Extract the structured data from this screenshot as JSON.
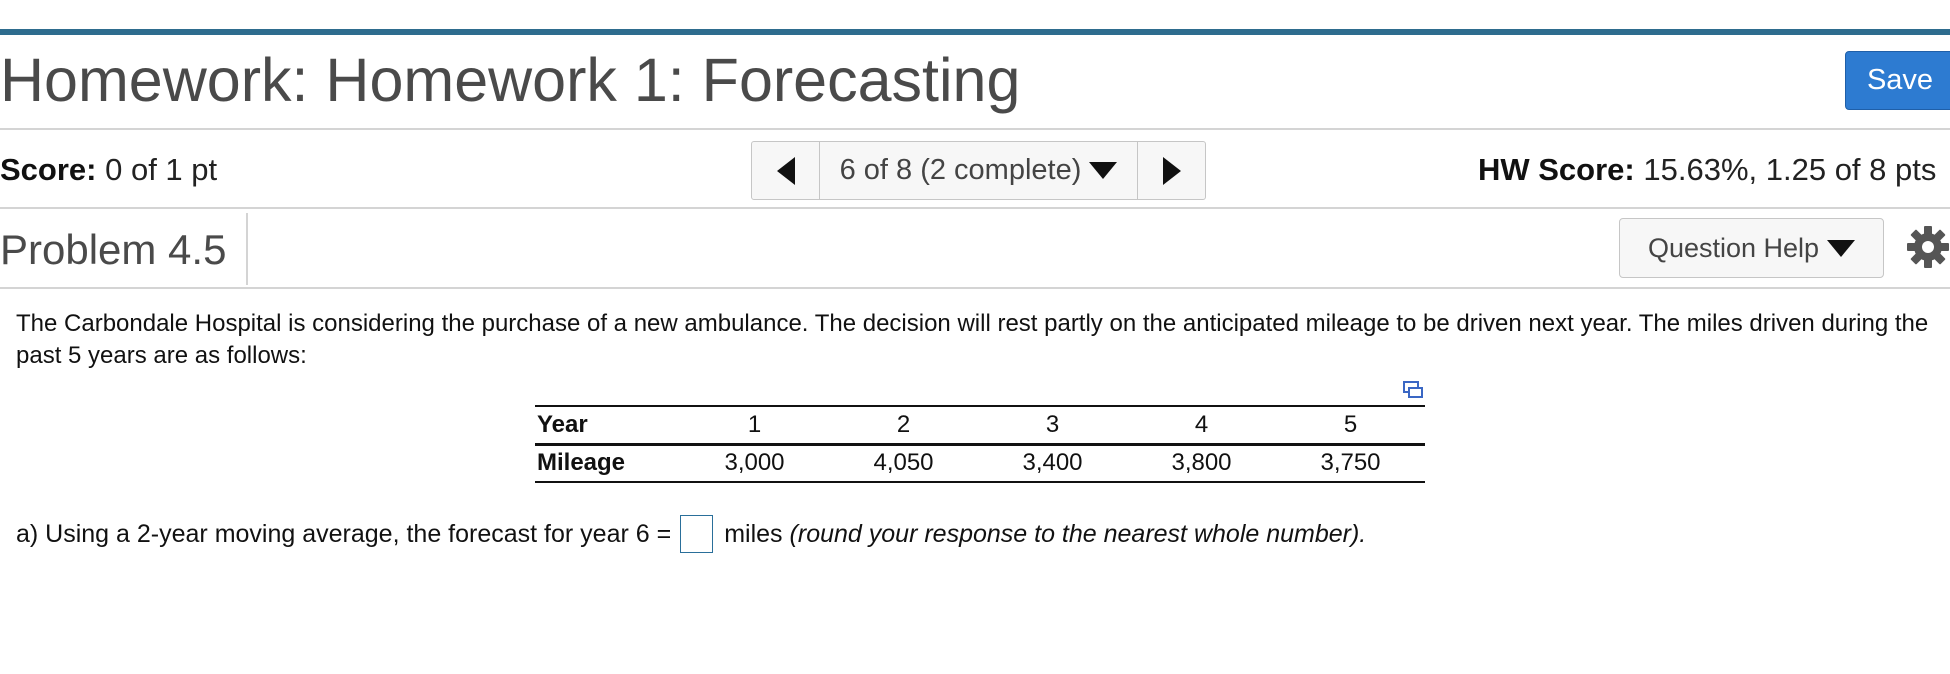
{
  "header": {
    "title": "Homework: Homework 1: Forecasting",
    "save_label": "Save"
  },
  "score_bar": {
    "score_label": "Score:",
    "score_value": "0 of 1 pt",
    "nav_position": "6 of 8 (2 complete)",
    "hw_score_label": "HW Score:",
    "hw_score_value": "15.63%, 1.25 of 8 pts"
  },
  "problem": {
    "title": "Problem 4.5",
    "help_label": "Question Help"
  },
  "question": {
    "text": "The Carbondale Hospital is considering the purchase of a new ambulance. The decision will rest partly on the anticipated mileage to be driven next year. The miles driven during the past 5 years are as follows:",
    "table": {
      "row1_label": "Year",
      "years": [
        "1",
        "2",
        "3",
        "4",
        "5"
      ],
      "row2_label": "Mileage",
      "mileage": [
        "3,000",
        "4,050",
        "3,400",
        "3,800",
        "3,750"
      ]
    },
    "part_a_prefix": "a) Using a 2-year moving average, the forecast for year 6 =",
    "part_a_unit": "miles",
    "part_a_note": "(round your response to the nearest whole number).",
    "part_a_value": ""
  },
  "icons": {
    "prev": "triangle-left-icon",
    "next": "triangle-right-icon",
    "dropdown": "triangle-down-icon",
    "settings": "gear-icon",
    "copy": "copy-table-icon"
  },
  "colors": {
    "top_bar": "#2e6c8e",
    "save_button": "#2d7bd1",
    "input_border": "#2a6f9a"
  }
}
